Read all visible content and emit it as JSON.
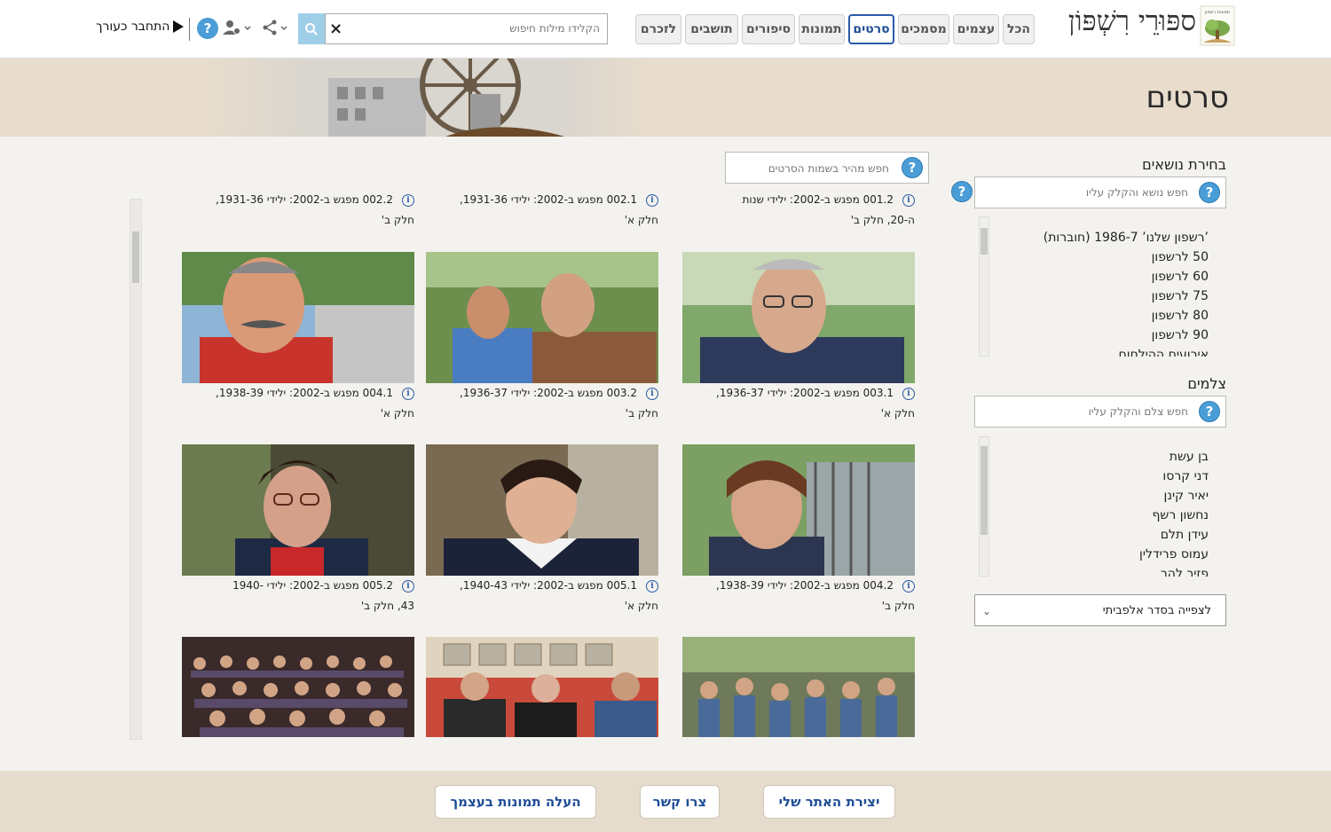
{
  "header": {
    "site_title": "ספּוּרֵי רִשְׁפּוֹן",
    "logo_text": "תמונות רשפון",
    "tabs": [
      {
        "label": "לזכרם",
        "active": false
      },
      {
        "label": "תושבים",
        "active": false
      },
      {
        "label": "סיפורים",
        "active": false
      },
      {
        "label": "תמונות",
        "active": false
      },
      {
        "label": "סרטים",
        "active": true
      },
      {
        "label": "מסמכים",
        "active": false
      },
      {
        "label": "עצמים",
        "active": false
      },
      {
        "label": "הכל",
        "active": false
      }
    ],
    "search": {
      "placeholder": "הקלידו מילות חיפוש",
      "clear": "×"
    },
    "help": "?",
    "login_label": "התחבר כעורך"
  },
  "page": {
    "title": "סרטים"
  },
  "sidebar": {
    "topics": {
      "title": "בחירת נושאים",
      "search_placeholder": "חפש נושא והקלק עליו",
      "help": "?",
      "items": [
        "’רשפון שלנו’ 1986-7 (חוברות)",
        "50 לרשפון",
        "60 לרשפון",
        "75 לרשפון",
        "80 לרשפון",
        "90 לרשפון",
        "אירועים ההילחום"
      ]
    },
    "photographers": {
      "title": "צלמים",
      "search_placeholder": "חפש צלם והקלק עליו",
      "help": "?",
      "items": [
        "בן עשת",
        "דני קרסו",
        "יאיר קינן",
        "נחשון רשף",
        "עידן תלם",
        "עמוס פרידלין",
        "פזיר להר"
      ]
    },
    "sort": {
      "value": "לצפייה בסדר אלפביתי"
    }
  },
  "films_search": {
    "placeholder": "חפש מהיר בשמות הסרטים",
    "help": "?"
  },
  "films": {
    "top_row": [
      {
        "line1": "001.2 מפגש ב-2002: ילידי שנות",
        "line2": "ה-20, חלק ב'"
      },
      {
        "line1": "002.1 מפגש ב-2002: ילידי 1931-36,",
        "line2": "חלק א'"
      },
      {
        "line1": "002.2 מפגש ב-2002: ילידי 1931-36,",
        "line2": "חלק ב'"
      }
    ],
    "rows": [
      [
        {
          "line1": "003.1 מפגש ב-2002: ילידי 1936-37,",
          "line2": "חלק א'",
          "scene": "man-glasses"
        },
        {
          "line1": "003.2 מפגש ב-2002: ילידי 1936-37,",
          "line2": "חלק ב'",
          "scene": "two-men"
        },
        {
          "line1": "004.1 מפגש ב-2002: ילידי 1938-39,",
          "line2": "חלק א'",
          "scene": "man-mustache"
        }
      ],
      [
        {
          "line1": "004.2 מפגש ב-2002: ילידי 1938-39,",
          "line2": "חלק ב'",
          "scene": "woman-fence"
        },
        {
          "line1": "005.1 מפגש ב-2002: ילידי 1940-43,",
          "line2": "חלק א'",
          "scene": "woman-collar"
        },
        {
          "line1": "005.2 מפגש ב-2002: ילידי -1940",
          "line2": "43, חלק ב'",
          "scene": "woman-glasses"
        }
      ],
      [
        {
          "line1": "",
          "line2": "",
          "scene": "crowd-outdoor"
        },
        {
          "line1": "",
          "line2": "",
          "scene": "group-indoor"
        },
        {
          "line1": "",
          "line2": "",
          "scene": "audience"
        }
      ]
    ]
  },
  "footer": {
    "buttons": [
      "יצירת האתר שלי",
      "צרו קשר",
      "העלה תמונות בעצמך"
    ]
  },
  "colors": {
    "accent": "#2a5aa8",
    "help": "#4a9dd6",
    "banner": "#e8dccc",
    "footer": "#e6dccd"
  }
}
